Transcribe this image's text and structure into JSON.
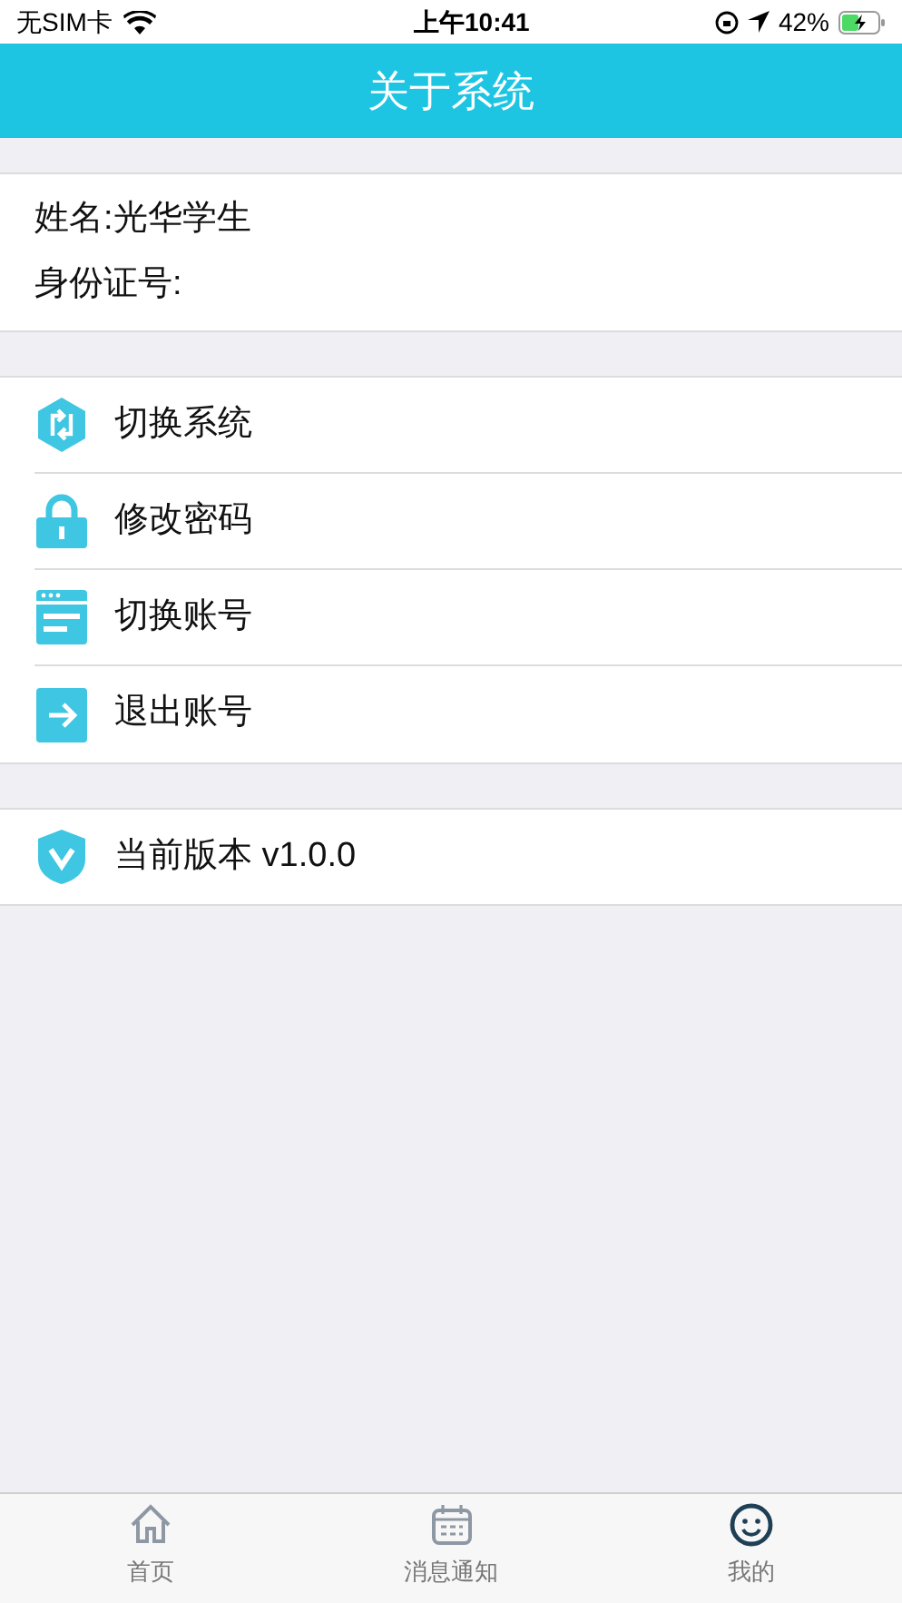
{
  "status_bar": {
    "carrier": "无SIM卡",
    "time": "上午10:41",
    "battery": "42%"
  },
  "header": {
    "title": "关于系统"
  },
  "profile": [
    {
      "label": "姓名:光华学生"
    },
    {
      "label": "身份证号:"
    }
  ],
  "menu": [
    {
      "kind": "switch-system",
      "label": "切换系统"
    },
    {
      "kind": "lock",
      "label": "修改密码"
    },
    {
      "kind": "window",
      "label": "切换账号"
    },
    {
      "kind": "exit",
      "label": "退出账号"
    }
  ],
  "version": {
    "label": "当前版本 v1.0.0"
  },
  "tab_bar": [
    {
      "kind": "home",
      "label": "首页",
      "selected": false
    },
    {
      "kind": "calendar",
      "label": "消息通知",
      "selected": false
    },
    {
      "kind": "smile",
      "label": "我的",
      "selected": true
    }
  ]
}
